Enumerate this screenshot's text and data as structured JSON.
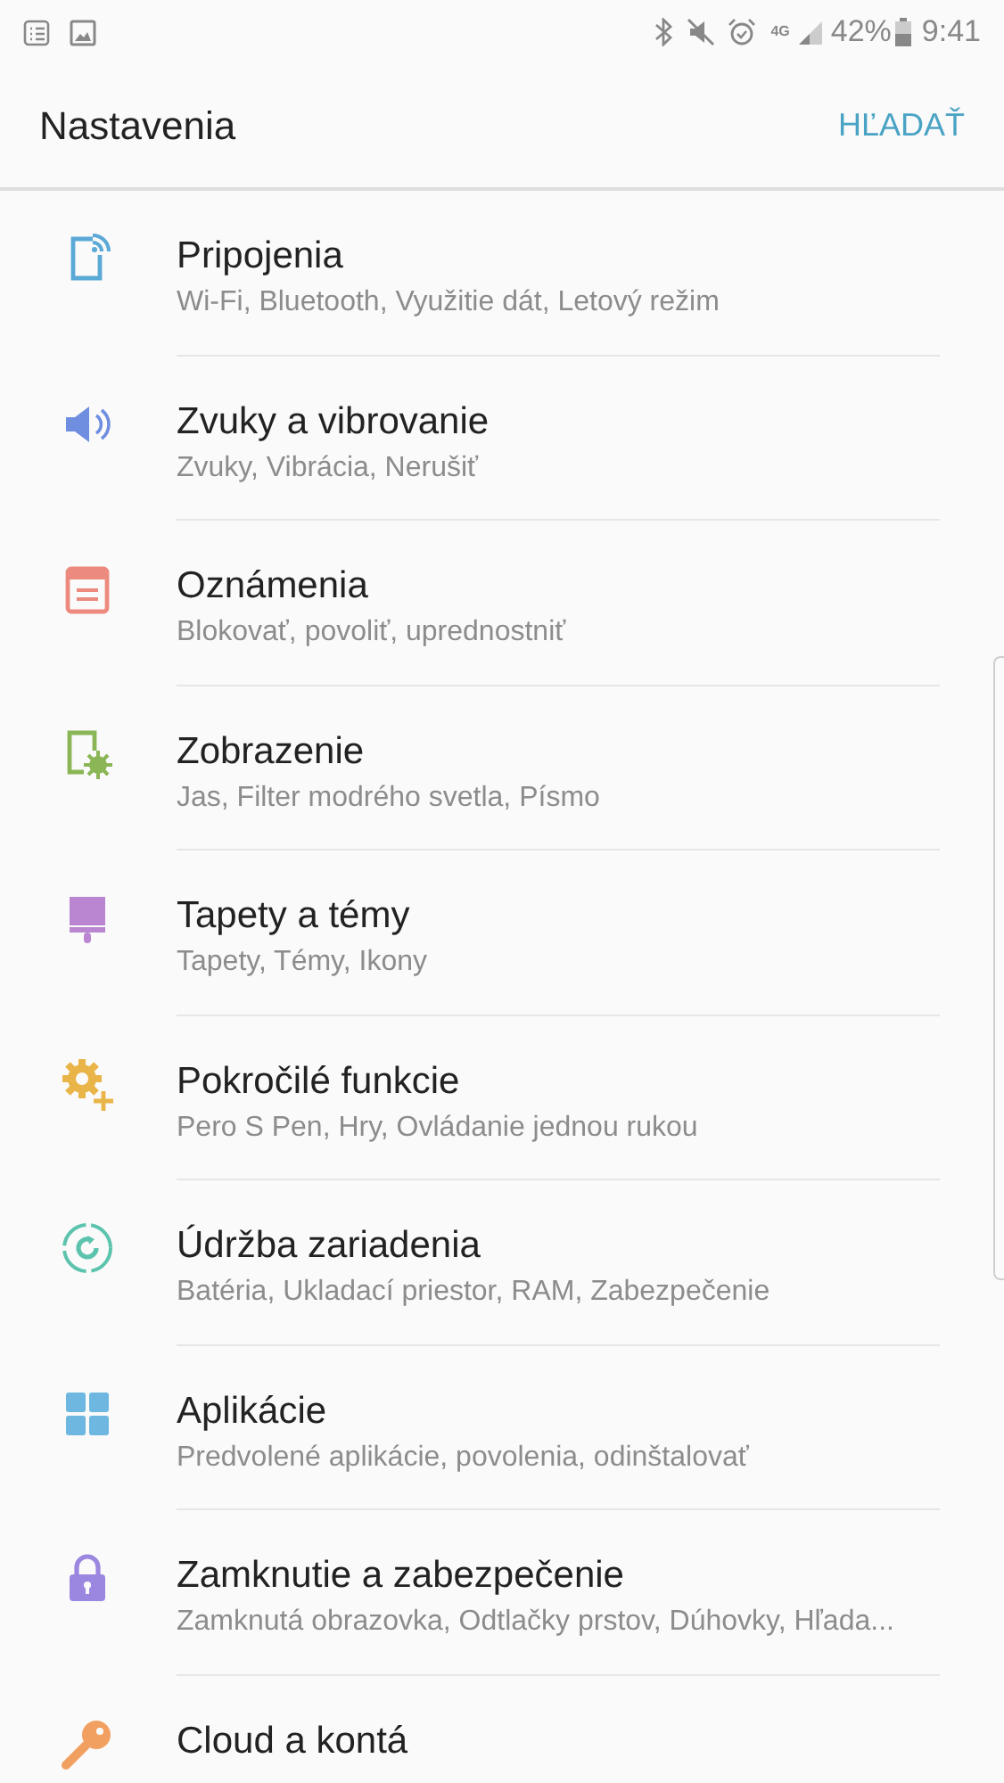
{
  "status_bar": {
    "network": "4G",
    "battery": "42%",
    "time": "9:41"
  },
  "header": {
    "title": "Nastavenia",
    "action": "HĽADAŤ"
  },
  "items": [
    {
      "kind": "connections",
      "color": "#5aa9d6",
      "title": "Pripojenia",
      "subtitle": "Wi-Fi, Bluetooth, Využitie dát, Letový režim"
    },
    {
      "kind": "sound",
      "color": "#6f8ee0",
      "title": "Zvuky a vibrovanie",
      "subtitle": "Zvuky, Vibrácia, Nerušiť"
    },
    {
      "kind": "notifications",
      "color": "#ec8a7d",
      "title": "Oznámenia",
      "subtitle": "Blokovať, povoliť, uprednostniť"
    },
    {
      "kind": "display",
      "color": "#8bb656",
      "title": "Zobrazenie",
      "subtitle": "Jas, Filter modrého svetla, Písmo"
    },
    {
      "kind": "themes",
      "color": "#bb86d1",
      "title": "Tapety a témy",
      "subtitle": "Tapety, Témy, Ikony"
    },
    {
      "kind": "advanced",
      "color": "#e9b548",
      "title": "Pokročilé funkcie",
      "subtitle": "Pero S Pen, Hry, Ovládanie jednou rukou"
    },
    {
      "kind": "maintenance",
      "color": "#5cc3ad",
      "title": "Údržba zariadenia",
      "subtitle": "Batéria, Ukladací priestor, RAM, Zabezpečenie"
    },
    {
      "kind": "apps",
      "color": "#6db7e0",
      "title": "Aplikácie",
      "subtitle": "Predvolené aplikácie, povolenia, odinštalovať"
    },
    {
      "kind": "lock",
      "color": "#9b86e0",
      "title": "Zamknutie a zabezpečenie",
      "subtitle": "Zamknutá obrazovka, Odtlačky prstov, Dúhovky, Hľada..."
    },
    {
      "kind": "cloud",
      "color": "#f2a061",
      "title": "Cloud a kontá"
    }
  ]
}
